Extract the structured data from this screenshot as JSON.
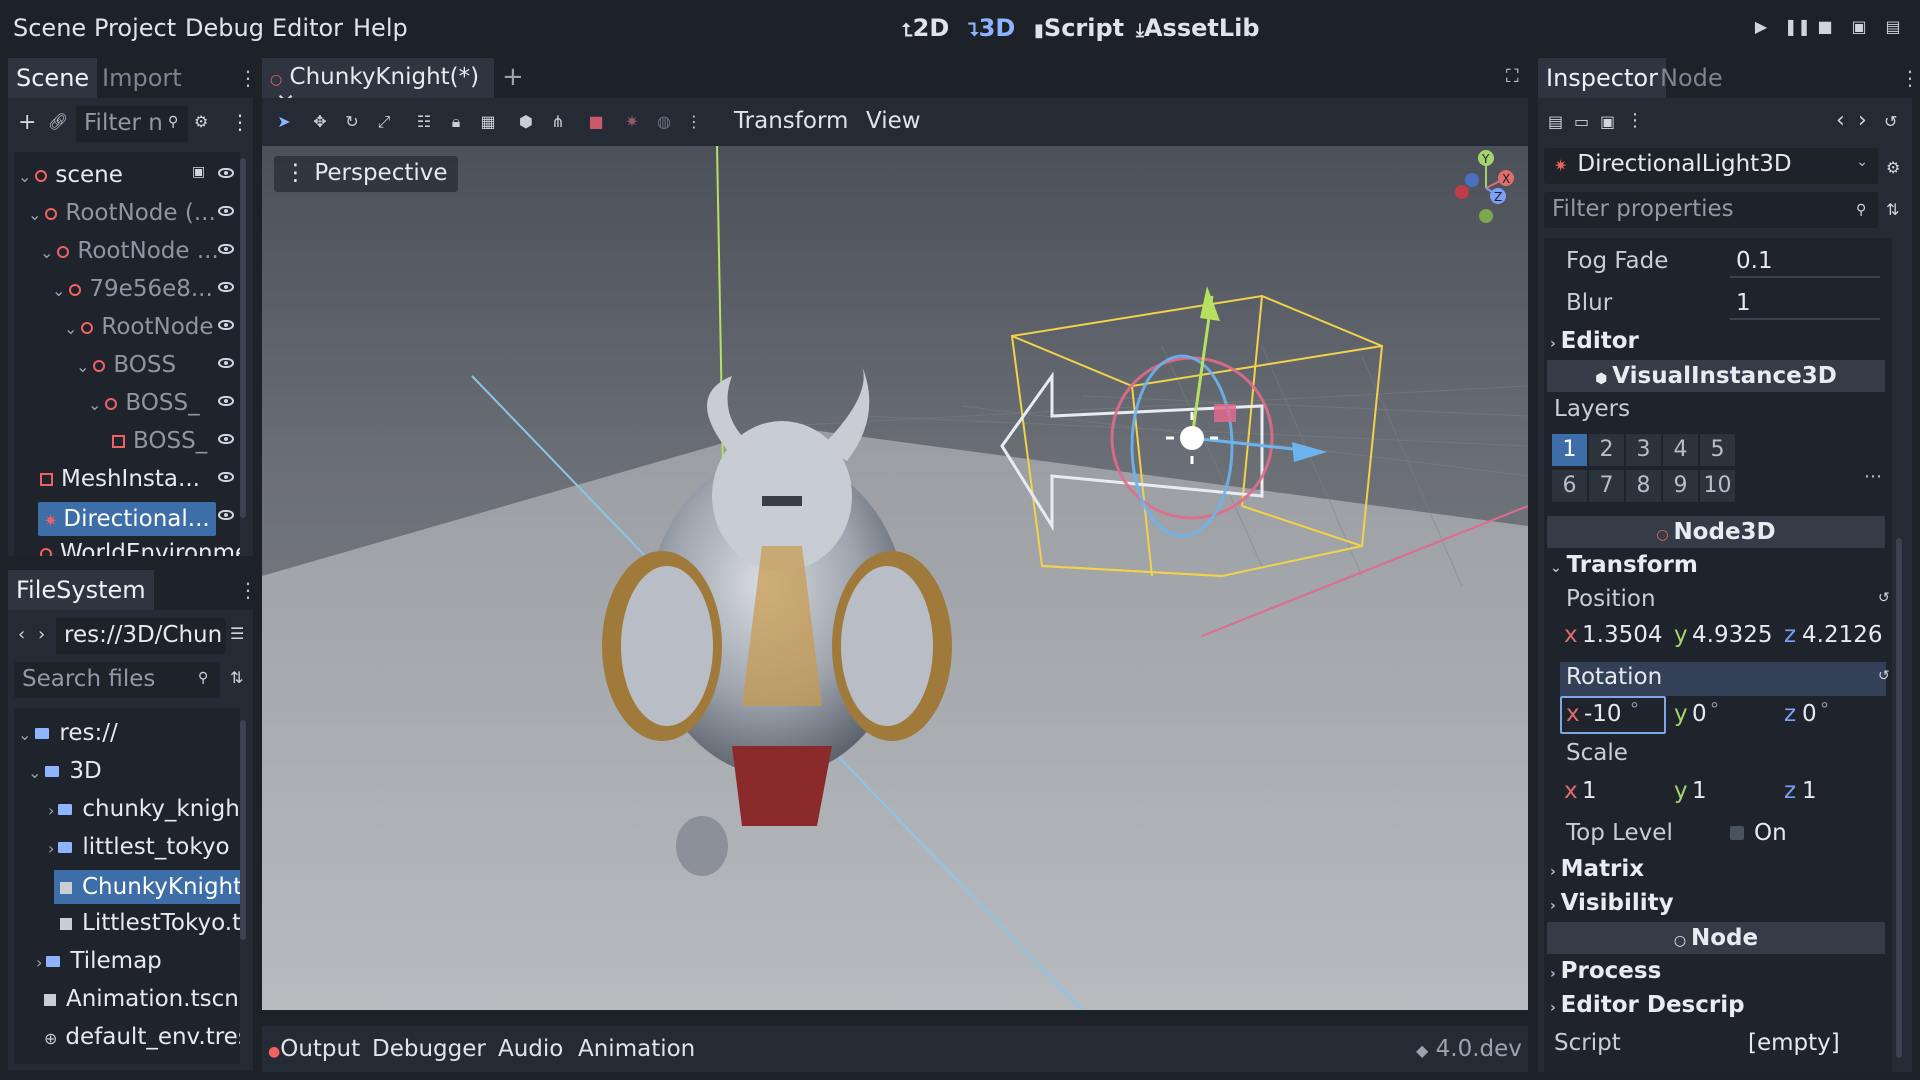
{
  "menu": [
    "Scene",
    "Project",
    "Debug",
    "Editor",
    "Help"
  ],
  "workspaces": [
    {
      "label": "2D",
      "icon": "2d-icon"
    },
    {
      "label": "3D",
      "icon": "3d-icon",
      "active": true
    },
    {
      "label": "Script",
      "icon": "script-icon"
    },
    {
      "label": "AssetLib",
      "icon": "assetlib-icon"
    }
  ],
  "scene_dock": {
    "tabs": [
      "Scene",
      "Import"
    ],
    "filter_placeholder": "Filter n",
    "tree": [
      {
        "label": "scene",
        "level": 0
      },
      {
        "label": "RootNode (...",
        "level": 1
      },
      {
        "label": "RootNode ...",
        "level": 2
      },
      {
        "label": "79e56e8...",
        "level": 3
      },
      {
        "label": "RootNode",
        "level": 4
      },
      {
        "label": "BOSS",
        "level": 5
      },
      {
        "label": "BOSS_",
        "level": 6
      },
      {
        "label": "BOSS_",
        "level": 7
      },
      {
        "label": "MeshInsta...",
        "level": 1
      },
      {
        "label": "Directional...",
        "level": 1,
        "selected": true
      },
      {
        "label": "WorldEnvironme",
        "level": 1
      }
    ]
  },
  "filesystem": {
    "title": "FileSystem",
    "path": "res://3D/Chun",
    "search_placeholder": "Search files",
    "items": [
      {
        "label": "res://",
        "type": "folder"
      },
      {
        "label": "3D",
        "type": "folder"
      },
      {
        "label": "chunky_knight",
        "type": "folder"
      },
      {
        "label": "littlest_tokyo",
        "type": "folder"
      },
      {
        "label": "ChunkyKnight.ts",
        "type": "file",
        "selected": true
      },
      {
        "label": "LittlestTokyo.tsc",
        "type": "file"
      },
      {
        "label": "Tilemap",
        "type": "folder"
      },
      {
        "label": "Animation.tscn",
        "type": "file"
      },
      {
        "label": "default_env.tres",
        "type": "file"
      }
    ]
  },
  "editor": {
    "tab_label": "ChunkyKnight(*)",
    "add_tab": "+",
    "toolbar_menus": [
      "Transform",
      "View"
    ],
    "viewport_label": "Perspective",
    "gizmo_axes": {
      "x": "X",
      "y": "Y",
      "z": "Z"
    }
  },
  "bottom_panel": {
    "tabs": [
      "Output",
      "Debugger",
      "Audio",
      "Animation"
    ],
    "version": "4.0.dev"
  },
  "inspector": {
    "tabs": [
      "Inspector",
      "Node"
    ],
    "node_type": "DirectionalLight3D",
    "filter_placeholder": "Filter properties",
    "fog_fade": {
      "label": "Fog Fade",
      "value": "0.1"
    },
    "blur": {
      "label": "Blur",
      "value": "1"
    },
    "editor_group": "Editor",
    "visual_instance": "VisualInstance3D",
    "layers_label": "Layers",
    "layers": [
      {
        "n": "1",
        "on": true
      },
      {
        "n": "2"
      },
      {
        "n": "3"
      },
      {
        "n": "4"
      },
      {
        "n": "5"
      },
      {
        "n": "6"
      },
      {
        "n": "7"
      },
      {
        "n": "8"
      },
      {
        "n": "9"
      },
      {
        "n": "10"
      }
    ],
    "node3d": "Node3D",
    "transform_group": "Transform",
    "position": {
      "label": "Position",
      "x": "1.3504",
      "y": "4.9325",
      "z": "4.2126"
    },
    "rotation": {
      "label": "Rotation",
      "x": "-10",
      "y": "0",
      "z": "0",
      "unit": "°"
    },
    "scale": {
      "label": "Scale",
      "x": "1",
      "y": "1",
      "z": "1"
    },
    "top_level": {
      "label": "Top Level",
      "value": "On"
    },
    "matrix_group": "Matrix",
    "visibility_group": "Visibility",
    "node_section": "Node",
    "process_group": "Process",
    "editor_desc_group": "Editor Descrip",
    "script": {
      "label": "Script",
      "value": "[empty]"
    },
    "axis": {
      "x": "x",
      "y": "y",
      "z": "z"
    }
  },
  "colors": {
    "accent": "#8fb4ff",
    "node_red": "#f06262",
    "selection": "#3e6ea8"
  }
}
